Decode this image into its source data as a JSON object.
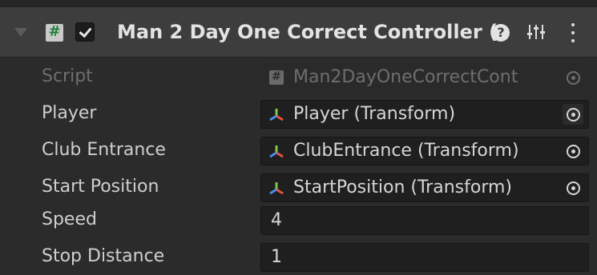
{
  "component": {
    "title": "Man 2 Day One Correct Controller (",
    "enabled": true,
    "icons": {
      "fold": "foldout-arrow-icon",
      "script": "script-hash-icon",
      "help": "help-icon",
      "presets": "presets-sliders-icon",
      "menu": "kebab-menu-icon"
    },
    "help_glyph": "?"
  },
  "fields": {
    "script": {
      "label": "Script",
      "value": "Man2DayOneCorrectCont",
      "disabled": true
    },
    "player": {
      "label": "Player",
      "value": "Player (Transform)"
    },
    "club_entrance": {
      "label": "Club Entrance",
      "value": "ClubEntrance (Transform)"
    },
    "start_position": {
      "label": "Start Position",
      "value": "StartPosition (Transform)"
    },
    "speed": {
      "label": "Speed",
      "value": "4"
    },
    "stop_distance": {
      "label": "Stop Distance",
      "value": "1"
    }
  },
  "colors": {
    "background": "#2b2b2b",
    "header": "#3d3d3d",
    "field": "#1f1f1f",
    "transform_axis_red": "#e5533c",
    "transform_axis_green": "#84c644",
    "transform_axis_blue": "#4a8fe7"
  }
}
